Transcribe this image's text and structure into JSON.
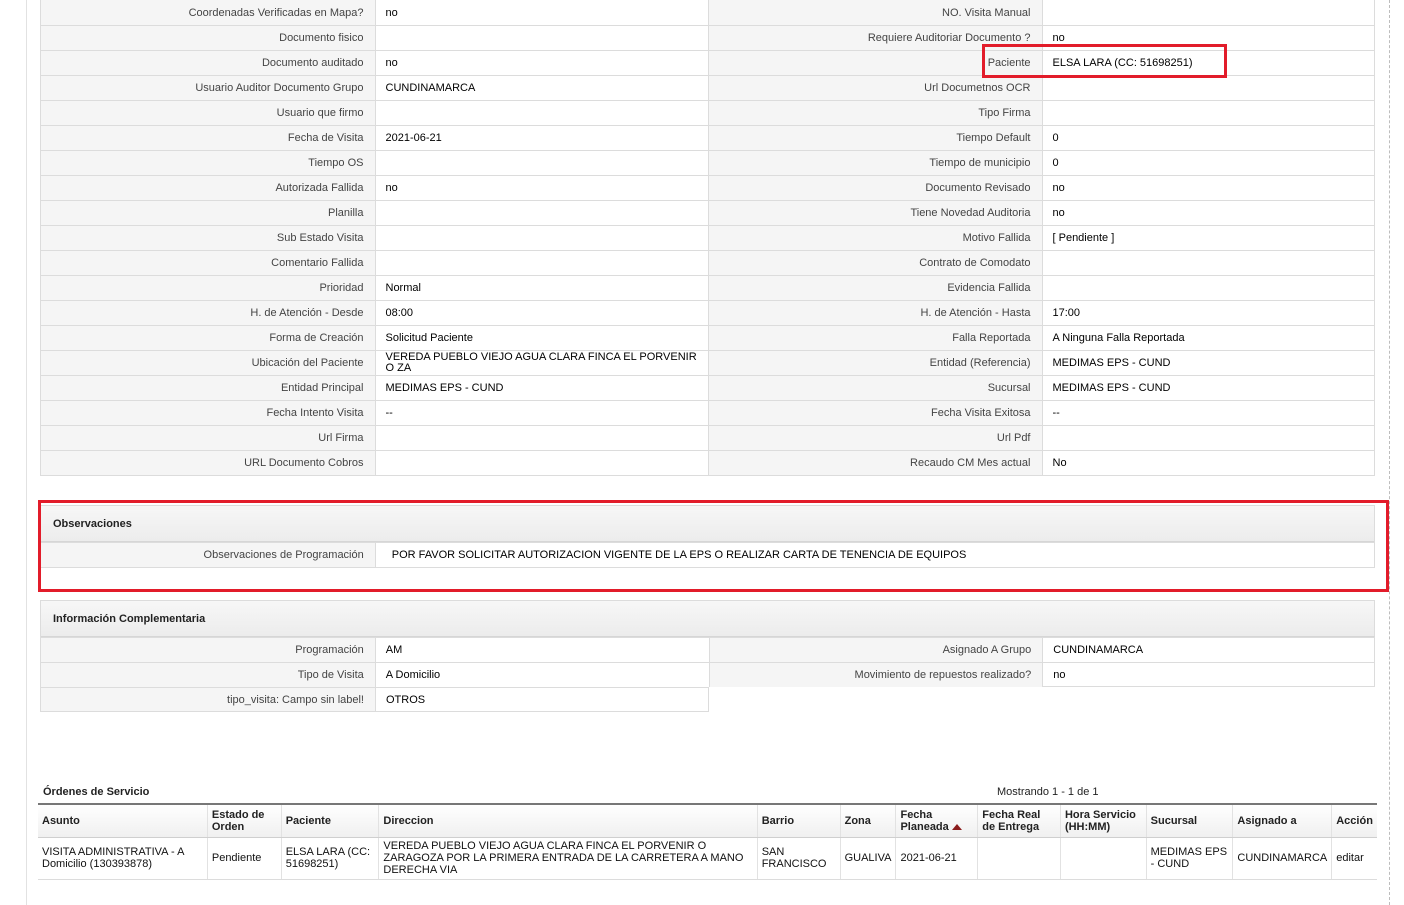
{
  "detail_rows": [
    [
      {
        "label": "Coordenadas Verificadas en Mapa?",
        "value": "no"
      },
      {
        "label": "NO. Visita Manual",
        "value": ""
      }
    ],
    [
      {
        "label": "Documento fisico",
        "value": ""
      },
      {
        "label": "Requiere Auditoriar Documento ?",
        "value": "no"
      }
    ],
    [
      {
        "label": "Documento auditado",
        "value": "no"
      },
      {
        "label": "Paciente",
        "value": "ELSA LARA (CC: 51698251)"
      }
    ],
    [
      {
        "label": "Usuario Auditor Documento Grupo",
        "value": "CUNDINAMARCA"
      },
      {
        "label": "Url Documetnos OCR",
        "value": ""
      }
    ],
    [
      {
        "label": "Usuario que firmo",
        "value": ""
      },
      {
        "label": "Tipo Firma",
        "value": ""
      }
    ],
    [
      {
        "label": "Fecha de Visita",
        "value": "2021-06-21"
      },
      {
        "label": "Tiempo Default",
        "value": "0"
      }
    ],
    [
      {
        "label": "Tiempo OS",
        "value": ""
      },
      {
        "label": "Tiempo de municipio",
        "value": "0"
      }
    ],
    [
      {
        "label": "Autorizada Fallida",
        "value": "no"
      },
      {
        "label": "Documento Revisado",
        "value": "no"
      }
    ],
    [
      {
        "label": "Planilla",
        "value": ""
      },
      {
        "label": "Tiene Novedad Auditoria",
        "value": "no"
      }
    ],
    [
      {
        "label": "Sub Estado Visita",
        "value": ""
      },
      {
        "label": "Motivo Fallida",
        "value": "[ Pendiente ]"
      }
    ],
    [
      {
        "label": "Comentario Fallida",
        "value": ""
      },
      {
        "label": "Contrato de Comodato",
        "value": ""
      }
    ],
    [
      {
        "label": "Prioridad",
        "value": "Normal"
      },
      {
        "label": "Evidencia Fallida",
        "value": ""
      }
    ],
    [
      {
        "label": "H. de Atención - Desde",
        "value": "08:00"
      },
      {
        "label": "H. de Atención - Hasta",
        "value": "17:00"
      }
    ],
    [
      {
        "label": "Forma de Creación",
        "value": "Solicitud Paciente"
      },
      {
        "label": "Falla Reportada",
        "value": "A Ninguna Falla Reportada"
      }
    ],
    [
      {
        "label": "Ubicación del Paciente",
        "value": "VEREDA PUEBLO VIEJO AGUA CLARA FINCA EL PORVENIR O ZA"
      },
      {
        "label": "Entidad (Referencia)",
        "value": "MEDIMAS EPS - CUND"
      }
    ],
    [
      {
        "label": "Entidad Principal",
        "value": "MEDIMAS EPS - CUND"
      },
      {
        "label": "Sucursal",
        "value": "MEDIMAS EPS - CUND"
      }
    ],
    [
      {
        "label": "Fecha Intento Visita",
        "value": "--"
      },
      {
        "label": "Fecha Visita Exitosa",
        "value": "--"
      }
    ],
    [
      {
        "label": "Url Firma",
        "value": ""
      },
      {
        "label": "Url Pdf",
        "value": ""
      }
    ],
    [
      {
        "label": "URL Documento Cobros",
        "value": ""
      },
      {
        "label": "Recaudo CM Mes actual",
        "value": "No"
      }
    ]
  ],
  "observaciones": {
    "title": "Observaciones",
    "label": "Observaciones de Programación",
    "value": "POR FAVOR SOLICITAR AUTORIZACION VIGENTE DE LA EPS O REALIZAR CARTA DE TENENCIA DE EQUIPOS"
  },
  "info_comp": {
    "title": "Información Complementaria",
    "rows": [
      [
        {
          "label": "Programación",
          "value": "AM"
        },
        {
          "label": "Asignado A Grupo",
          "value": "CUNDINAMARCA"
        }
      ],
      [
        {
          "label": "Tipo de Visita",
          "value": "A Domicilio"
        },
        {
          "label": "Movimiento de repuestos realizado?",
          "value": "no"
        }
      ],
      [
        {
          "label": "tipo_visita: Campo sin label!",
          "value": "OTROS"
        }
      ]
    ]
  },
  "orders": {
    "title": "Órdenes de Servicio",
    "count_text": "Mostrando 1 - 1 de 1",
    "headers": [
      "Asunto",
      "Estado de Orden",
      "Paciente",
      "Direccion",
      "Barrio",
      "Zona",
      "Fecha Planeada",
      "Fecha Real de Entrega",
      "Hora Servicio (HH:MM)",
      "Sucursal",
      "Asignado a",
      "Acción"
    ],
    "rows": [
      {
        "asunto": "VISITA ADMINISTRATIVA - A Domicilio (130393878)",
        "estado": "Pendiente",
        "paciente": "ELSA LARA (CC: 51698251)",
        "direccion": "VEREDA PUEBLO VIEJO AGUA CLARA FINCA EL PORVENIR O ZARAGOZA POR LA PRIMERA ENTRADA DE LA CARRETERA A MANO DERECHA VIA",
        "barrio": "SAN FRANCISCO",
        "zona": "GUALIVA",
        "fecha_planeada": "2021-06-21",
        "fecha_real": "",
        "hora_servicio": "",
        "sucursal": "MEDIMAS EPS - CUND",
        "asignado": "CUNDINAMARCA",
        "accion": "editar"
      }
    ]
  },
  "colors": {
    "highlight": "#e21c2a"
  }
}
